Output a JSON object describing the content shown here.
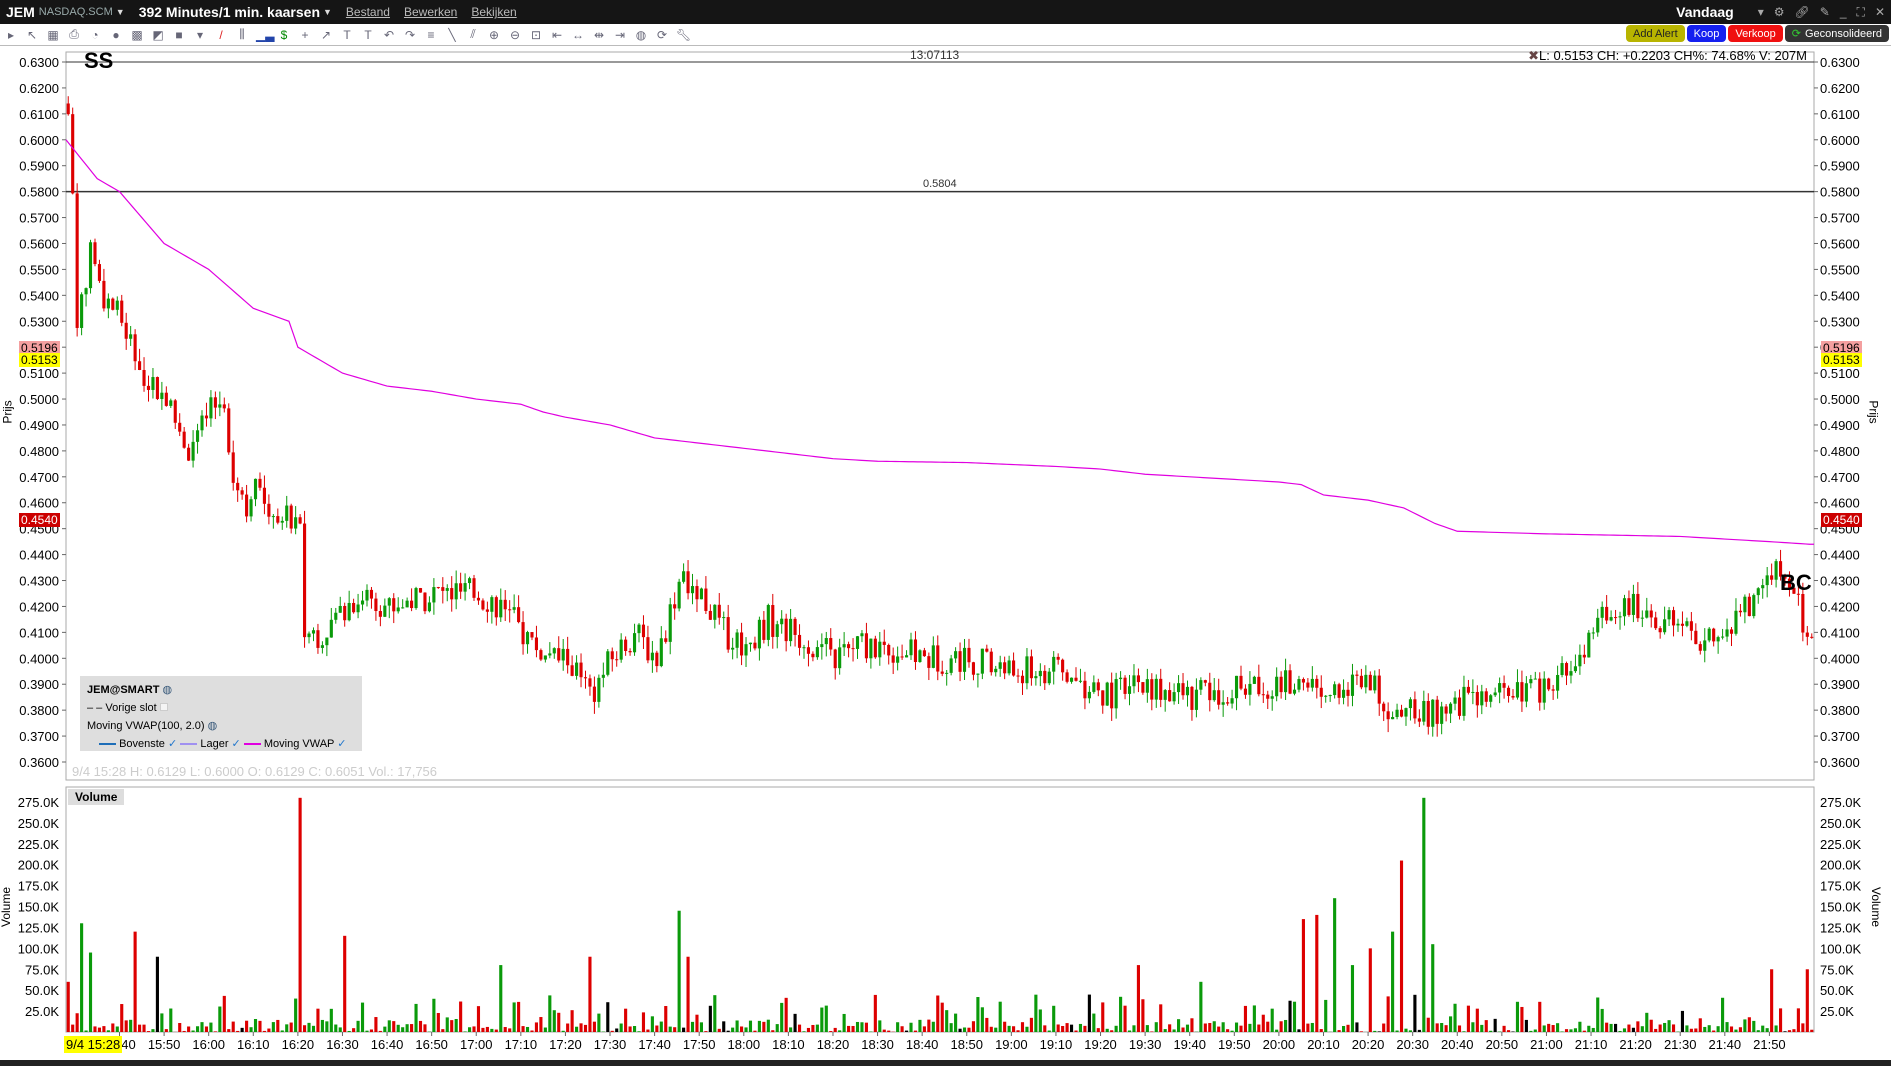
{
  "header": {
    "symbol": "JEM",
    "exchange": "NASDAQ.SCM",
    "period": "392 Minutes/1 min. kaarsen",
    "menus": [
      "Bestand",
      "Bewerken",
      "Bekijken"
    ],
    "range": "Vandaag"
  },
  "buttons": {
    "alert": "Add Alert",
    "buy": "Koop",
    "sell": "Verkoop",
    "consolidated": "Geconsolideerd"
  },
  "info": {
    "quote": "L: 0.5153 CH: +0.2203 CH%: 74.68% V: 207M",
    "overlap": "13:07113",
    "hline_label": "0.5804",
    "ohlc": "9/4 15:28   H: 0.6129   L: 0.6000   O: 0.6129   C: 0.6051   Vol.: 17,756",
    "date_tag": "9/4 15:28"
  },
  "markers": {
    "ss": "SS",
    "bc": "BC"
  },
  "price_tags": {
    "a": "0.5196",
    "b": "0.5153",
    "c": "0.4540"
  },
  "axis_titles": {
    "price": "Prijs",
    "volume": "Volume"
  },
  "legend": {
    "title": "JEM@SMART",
    "prev": "Vorige slot",
    "study": "Moving VWAP(100, 2.0)",
    "upper": "Bovenste",
    "lower": "Lager",
    "vwap": "Moving VWAP"
  },
  "volume_panel": {
    "label": "Volume"
  },
  "colors": {
    "up": "#0a9a0a",
    "down": "#dd0000",
    "vwap": "#e000e0",
    "tag_yellow": "#ffff00",
    "tag_red": "#cc0000",
    "tag_pink": "#f4a0a0"
  },
  "chart_data": {
    "type": "candlestick",
    "price_ticks": [
      "0.6300",
      "0.6200",
      "0.6100",
      "0.6000",
      "0.5900",
      "0.5800",
      "0.5700",
      "0.5600",
      "0.5500",
      "0.5400",
      "0.5300",
      "0.5200",
      "0.5100",
      "0.5000",
      "0.4900",
      "0.4800",
      "0.4700",
      "0.4600",
      "0.4500",
      "0.4400",
      "0.4300",
      "0.4200",
      "0.4100",
      "0.4000",
      "0.3900",
      "0.3800",
      "0.3700",
      "0.3600"
    ],
    "ylim": [
      0.36,
      0.63
    ],
    "volume_ticks": [
      "25.0K",
      "50.0K",
      "75.0K",
      "100.0K",
      "125.0K",
      "150.0K",
      "175.0K",
      "200.0K",
      "225.0K",
      "250.0K",
      "275.0K"
    ],
    "time_ticks": [
      "15:40",
      "15:50",
      "16:00",
      "16:10",
      "16:20",
      "16:30",
      "16:40",
      "16:50",
      "17:00",
      "17:10",
      "17:20",
      "17:30",
      "17:40",
      "17:50",
      "18:00",
      "18:10",
      "18:20",
      "18:30",
      "18:40",
      "18:50",
      "19:00",
      "19:10",
      "19:20",
      "19:30",
      "19:40",
      "19:50",
      "20:00",
      "20:10",
      "20:20",
      "20:30",
      "20:40",
      "20:50",
      "21:00",
      "21:10",
      "21:20",
      "21:30",
      "21:40",
      "21:50"
    ],
    "start": "15:28",
    "minutes": 392,
    "hline": 0.58,
    "close_path": [
      [
        0,
        0.61
      ],
      [
        1,
        0.58
      ],
      [
        2,
        0.53
      ],
      [
        5,
        0.555
      ],
      [
        8,
        0.54
      ],
      [
        12,
        0.53
      ],
      [
        17,
        0.51
      ],
      [
        22,
        0.5
      ],
      [
        27,
        0.48
      ],
      [
        32,
        0.495
      ],
      [
        35,
        0.5
      ],
      [
        37,
        0.47
      ],
      [
        40,
        0.46
      ],
      [
        42,
        0.465
      ],
      [
        47,
        0.455
      ],
      [
        52,
        0.455
      ],
      [
        53,
        0.41
      ],
      [
        57,
        0.41
      ],
      [
        62,
        0.42
      ],
      [
        67,
        0.425
      ],
      [
        72,
        0.42
      ],
      [
        82,
        0.425
      ],
      [
        92,
        0.425
      ],
      [
        97,
        0.42
      ],
      [
        102,
        0.41
      ],
      [
        107,
        0.4
      ],
      [
        112,
        0.4
      ],
      [
        117,
        0.385
      ],
      [
        122,
        0.4
      ],
      [
        127,
        0.41
      ],
      [
        132,
        0.4
      ],
      [
        137,
        0.43
      ],
      [
        142,
        0.425
      ],
      [
        147,
        0.41
      ],
      [
        152,
        0.405
      ],
      [
        157,
        0.415
      ],
      [
        162,
        0.41
      ],
      [
        167,
        0.405
      ],
      [
        172,
        0.4
      ],
      [
        177,
        0.405
      ],
      [
        182,
        0.405
      ],
      [
        192,
        0.4
      ],
      [
        202,
        0.4
      ],
      [
        212,
        0.395
      ],
      [
        222,
        0.395
      ],
      [
        232,
        0.385
      ],
      [
        242,
        0.39
      ],
      [
        252,
        0.385
      ],
      [
        262,
        0.388
      ],
      [
        272,
        0.39
      ],
      [
        282,
        0.39
      ],
      [
        292,
        0.39
      ],
      [
        297,
        0.38
      ],
      [
        302,
        0.378
      ],
      [
        312,
        0.383
      ],
      [
        322,
        0.385
      ],
      [
        332,
        0.388
      ],
      [
        337,
        0.395
      ],
      [
        342,
        0.41
      ],
      [
        347,
        0.42
      ],
      [
        352,
        0.42
      ],
      [
        357,
        0.415
      ],
      [
        362,
        0.41
      ],
      [
        367,
        0.405
      ],
      [
        372,
        0.41
      ],
      [
        377,
        0.42
      ],
      [
        382,
        0.435
      ],
      [
        387,
        0.425
      ],
      [
        391,
        0.405
      ]
    ],
    "vwap_path": [
      [
        0,
        0.6
      ],
      [
        7,
        0.585
      ],
      [
        12,
        0.58
      ],
      [
        17,
        0.57
      ],
      [
        22,
        0.56
      ],
      [
        32,
        0.55
      ],
      [
        42,
        0.535
      ],
      [
        50,
        0.53
      ],
      [
        52,
        0.52
      ],
      [
        57,
        0.515
      ],
      [
        62,
        0.51
      ],
      [
        72,
        0.505
      ],
      [
        82,
        0.503
      ],
      [
        92,
        0.5
      ],
      [
        102,
        0.498
      ],
      [
        107,
        0.495
      ],
      [
        112,
        0.493
      ],
      [
        122,
        0.49
      ],
      [
        132,
        0.485
      ],
      [
        142,
        0.483
      ],
      [
        152,
        0.481
      ],
      [
        162,
        0.479
      ],
      [
        172,
        0.477
      ],
      [
        182,
        0.476
      ],
      [
        202,
        0.4755
      ],
      [
        222,
        0.474
      ],
      [
        232,
        0.473
      ],
      [
        242,
        0.471
      ],
      [
        252,
        0.47
      ],
      [
        262,
        0.469
      ],
      [
        272,
        0.468
      ],
      [
        277,
        0.467
      ],
      [
        282,
        0.463
      ],
      [
        292,
        0.461
      ],
      [
        300,
        0.458
      ],
      [
        307,
        0.452
      ],
      [
        312,
        0.449
      ],
      [
        332,
        0.448
      ],
      [
        362,
        0.447
      ],
      [
        382,
        0.445
      ],
      [
        391,
        0.444
      ]
    ],
    "volume_spikes": [
      [
        0,
        60000
      ],
      [
        3,
        130000
      ],
      [
        5,
        95000
      ],
      [
        15,
        120000
      ],
      [
        20,
        90000
      ],
      [
        52,
        280000
      ],
      [
        62,
        115000
      ],
      [
        97,
        80000
      ],
      [
        117,
        90000
      ],
      [
        137,
        145000
      ],
      [
        139,
        90000
      ],
      [
        240,
        80000
      ],
      [
        254,
        60000
      ],
      [
        277,
        135000
      ],
      [
        280,
        140000
      ],
      [
        284,
        160000
      ],
      [
        288,
        80000
      ],
      [
        292,
        100000
      ],
      [
        297,
        120000
      ],
      [
        299,
        205000
      ],
      [
        304,
        280000
      ],
      [
        306,
        105000
      ],
      [
        382,
        75000
      ],
      [
        390,
        75000
      ]
    ]
  }
}
